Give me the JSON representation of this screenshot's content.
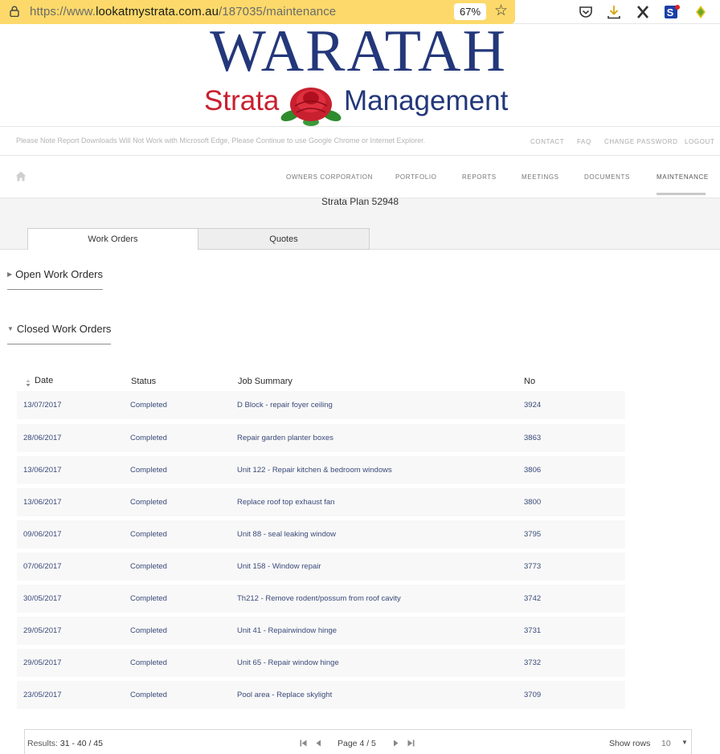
{
  "browser": {
    "url_prefix": "https://www.",
    "url_domain": "lookatmystrata.com.au",
    "url_path": "/187035/maintenance",
    "zoom": "67%"
  },
  "logo": {
    "line1": "WARATAH",
    "word_strata": "Strata",
    "word_management": "Management"
  },
  "notice": "Please Note Report Downloads Will Not Work with Microsoft Edge, Please Continue to use Google Chrome or Internet Explorer.",
  "top_links": [
    "CONTACT",
    "FAQ",
    "CHANGE PASSWORD",
    "LOGOUT"
  ],
  "nav": {
    "items": [
      "OWNERS CORPORATION",
      "PORTFOLIO",
      "REPORTS",
      "MEETINGS",
      "DOCUMENTS",
      "MAINTENANCE"
    ],
    "active": "MAINTENANCE"
  },
  "plan_name": "Strata Plan 52948",
  "tabs": [
    "Work Orders",
    "Quotes"
  ],
  "sections": {
    "open": "Open Work Orders",
    "closed": "Closed Work Orders"
  },
  "table": {
    "headers": [
      "Date",
      "Status",
      "Job Summary",
      "No"
    ],
    "rows": [
      [
        "13/07/2017",
        "Completed",
        "D Block - repair foyer ceiling",
        "3924"
      ],
      [
        "28/06/2017",
        "Completed",
        "Repair garden planter boxes",
        "3863"
      ],
      [
        "13/06/2017",
        "Completed",
        "Unit 122 - Repair kitchen & bedroom windows",
        "3806"
      ],
      [
        "13/06/2017",
        "Completed",
        "Replace roof top exhaust fan",
        "3800"
      ],
      [
        "09/06/2017",
        "Completed",
        "Unit 88 - seal leaking window",
        "3795"
      ],
      [
        "07/06/2017",
        "Completed",
        "Unit 158 - Window repair",
        "3773"
      ],
      [
        "30/05/2017",
        "Completed",
        "Th212 - Remove rodent/possum from roof cavity",
        "3742"
      ],
      [
        "29/05/2017",
        "Completed",
        "Unit 41 - Repairwindow hinge",
        "3731"
      ],
      [
        "29/05/2017",
        "Completed",
        "Unit 65 - Repair window hinge",
        "3732"
      ],
      [
        "23/05/2017",
        "Completed",
        "Pool area - Replace skylight",
        "3709"
      ]
    ]
  },
  "pager": {
    "results_label": "Results:",
    "results_value": "31 - 40 / 45",
    "page_text": "Page 4 / 5",
    "show_rows_label": "Show rows",
    "rows_value": "10"
  },
  "colors": {
    "url_bar": "#fcd96a",
    "logo_blue": "#23377a",
    "logo_red": "#c8202f",
    "row_text": "#3a4a7a"
  }
}
